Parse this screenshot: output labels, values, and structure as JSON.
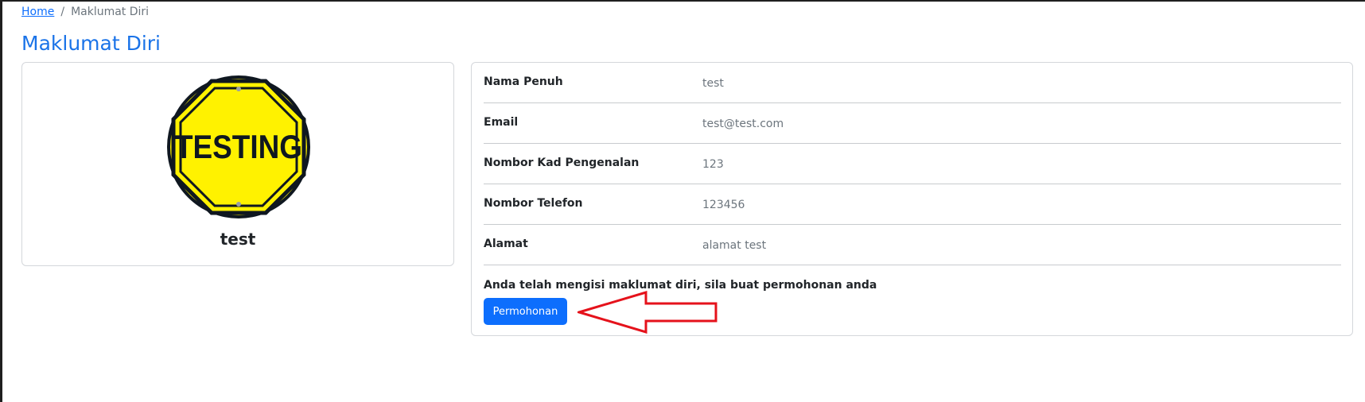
{
  "breadcrumb": {
    "home": "Home",
    "separator": "/",
    "current": "Maklumat Diri"
  },
  "page": {
    "title": "Maklumat Diri"
  },
  "profile": {
    "avatar_text": "TESTING",
    "avatar_description": "yellow octagon sign",
    "name": "test"
  },
  "details": {
    "rows": [
      {
        "label": "Nama Penuh",
        "value": "test"
      },
      {
        "label": "Email",
        "value": "test@test.com"
      },
      {
        "label": "Nombor Kad Pengenalan",
        "value": "123"
      },
      {
        "label": "Nombor Telefon",
        "value": "123456"
      },
      {
        "label": "Alamat",
        "value": "alamat test"
      }
    ],
    "notice": "Anda telah mengisi maklumat diri, sila buat permohonan anda",
    "button_label": "Permohonan"
  },
  "colors": {
    "primary": "#0d6efd",
    "title": "#1a73e8",
    "annotation_arrow": "#e5121b",
    "sign_yellow": "#fff200"
  }
}
